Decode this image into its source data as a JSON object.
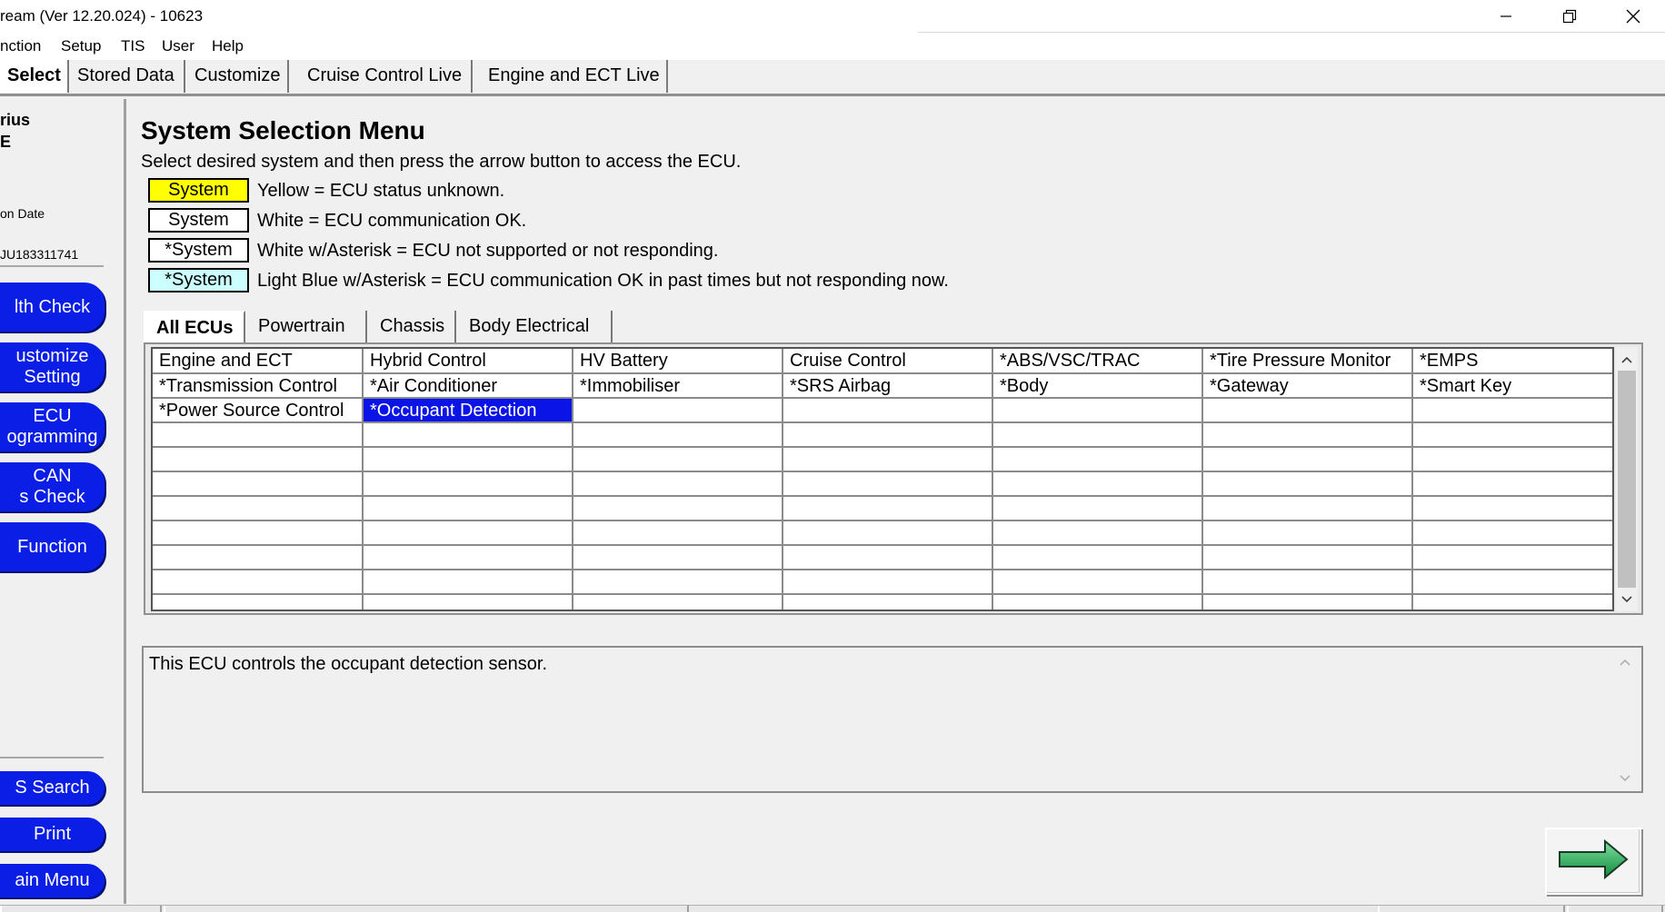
{
  "window": {
    "title": "ream (Ver 12.20.024) - 10623",
    "controls": {
      "minimize_icon": "minimize-icon",
      "restore_icon": "restore-icon",
      "close_icon": "close-icon"
    }
  },
  "menu": {
    "items": [
      "nction",
      "Setup",
      "TIS",
      "User",
      "Help"
    ]
  },
  "top_tabs": [
    {
      "label": "Select",
      "active": true
    },
    {
      "label": "Stored Data",
      "active": false
    },
    {
      "label": "Customize",
      "active": false
    },
    {
      "label": "Cruise Control Live",
      "active": false
    },
    {
      "label": "Engine and ECT Live",
      "active": false
    }
  ],
  "sidebar": {
    "vehicle_line1": "rius",
    "vehicle_line2": "E",
    "date_label": "on Date",
    "vin": "JU183311741",
    "buttons": [
      {
        "line1": "lth Check",
        "line2": ""
      },
      {
        "line1": "ustomize",
        "line2": "Setting"
      },
      {
        "line1": "ECU",
        "line2": "ogramming"
      },
      {
        "line1": "CAN",
        "line2": "s Check"
      },
      {
        "line1": "Function",
        "line2": ""
      }
    ],
    "bottom_buttons": [
      "S Search",
      "Print",
      "ain Menu"
    ]
  },
  "main": {
    "heading": "System Selection Menu",
    "instruction": "Select desired system and then press the arrow button to access the ECU.",
    "legend": [
      {
        "label": "System",
        "text": "Yellow = ECU status unknown.",
        "color": "#ffff00"
      },
      {
        "label": "System",
        "text": "White = ECU communication OK.",
        "color": "#ffffff"
      },
      {
        "label": "*System",
        "text": "White w/Asterisk = ECU not supported or not responding.",
        "color": "#ffffff"
      },
      {
        "label": "*System",
        "text": "Light Blue w/Asterisk = ECU communication OK in past times but not responding now.",
        "color": "#ccffff"
      }
    ],
    "sub_tabs": [
      {
        "label": "All ECUs",
        "active": true
      },
      {
        "label": "Powertrain",
        "active": false
      },
      {
        "label": "Chassis",
        "active": false
      },
      {
        "label": "Body Electrical",
        "active": false
      }
    ],
    "ecu_grid": [
      [
        "Engine and ECT",
        "Hybrid Control",
        "HV Battery",
        "Cruise Control",
        "*ABS/VSC/TRAC",
        "*Tire Pressure Monitor",
        "*EMPS"
      ],
      [
        "*Transmission Control",
        "*Air Conditioner",
        "*Immobiliser",
        "*SRS Airbag",
        "*Body",
        "*Gateway",
        "*Smart Key"
      ],
      [
        "*Power Source Control",
        "*Occupant Detection",
        "",
        "",
        "",
        "",
        ""
      ]
    ],
    "selected_cell": "*Occupant Detection",
    "empty_rows": 8,
    "description": "This ECU controls the occupant detection sensor.",
    "next_button_icon": "right-arrow-icon",
    "colors": {
      "selection": "#0a14e6",
      "sidebar_button": "#0a1ee6",
      "arrow": "#1aa84a"
    }
  }
}
